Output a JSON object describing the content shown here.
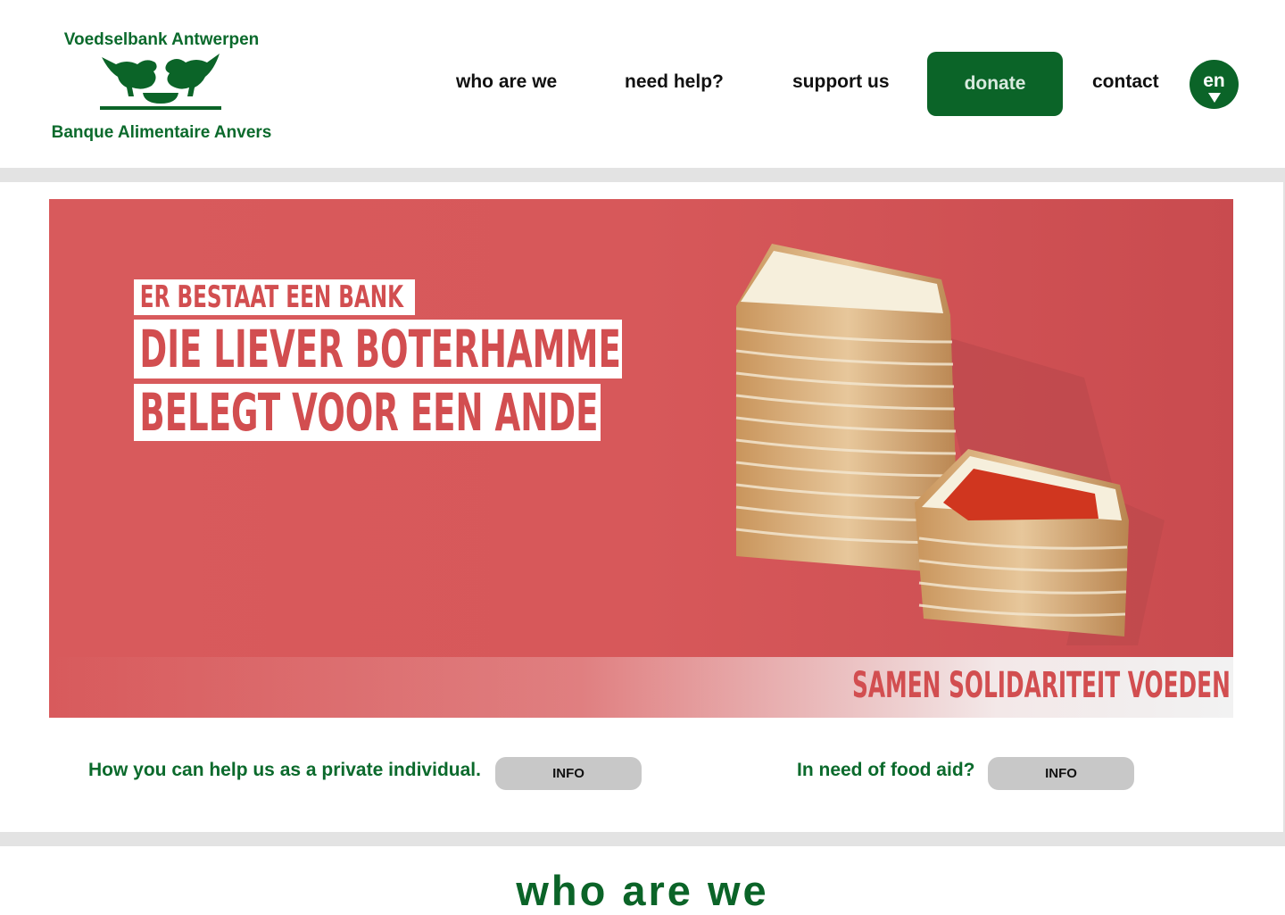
{
  "logo": {
    "name_nl": "Voedselbank Antwerpen",
    "name_fr": "Banque Alimentaire Anvers"
  },
  "nav": {
    "who": "who are we",
    "help": "need help?",
    "support": "support us",
    "donate": "donate",
    "contact": "contact",
    "language": "en"
  },
  "hero": {
    "line1": "ER BESTAAT EEN BANK",
    "line2": "DIE LIEVER BOTERHAMMEN",
    "line3": "BELEGT VOOR EEN ANDER.",
    "tagline": "SAMEN SOLIDARITEIT VOEDEN"
  },
  "cta": {
    "individual_text": "How you can help us as a private individual.",
    "individual_button": "INFO",
    "food_aid_text": "In need of food aid?",
    "food_aid_button": "INFO"
  },
  "sections": {
    "who_title": "who are we"
  },
  "colors": {
    "brand_green": "#0b6428",
    "hero_red": "#d85a5c",
    "button_grey": "#c8c8c8"
  }
}
